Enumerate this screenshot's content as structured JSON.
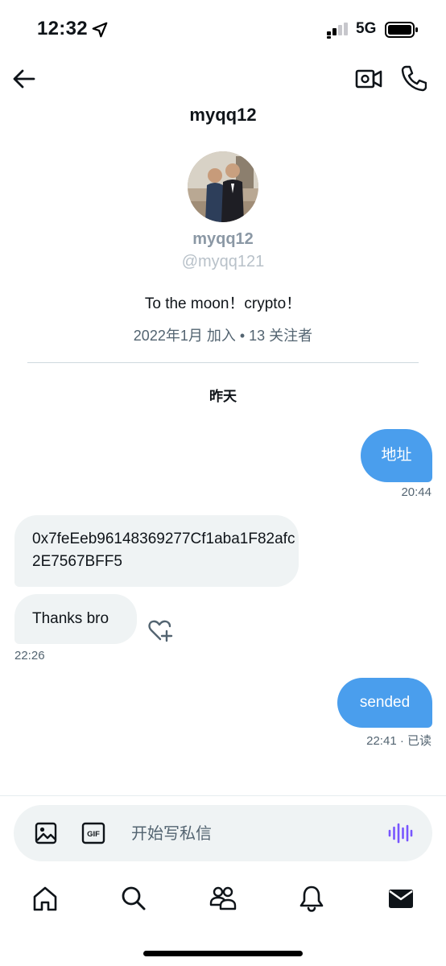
{
  "status_bar": {
    "time": "12:32",
    "network": "5G",
    "icons": [
      "location-arrow-icon",
      "signal-icon",
      "battery-icon"
    ]
  },
  "header": {
    "title": "myqq12",
    "icons": [
      "back-arrow-icon",
      "video-call-icon",
      "phone-call-icon"
    ]
  },
  "profile": {
    "name": "myqq12",
    "handle": "@myqq121",
    "bio": "To the moon！crypto！",
    "meta": "2022年1月 加入 • 13 关注者"
  },
  "conversation": {
    "day_label": "昨天",
    "messages": [
      {
        "direction": "outgoing",
        "text": "地址",
        "time": "20:44"
      },
      {
        "direction": "incoming",
        "text": "0x7feEeb96148369277Cf1aba1F82afc2E7567BFF5"
      },
      {
        "direction": "incoming",
        "text": "Thanks bro",
        "time": "22:26"
      },
      {
        "direction": "outgoing",
        "text": "sended",
        "time": "22:41 · 已读"
      }
    ]
  },
  "composer": {
    "placeholder": "开始写私信",
    "icons": [
      "image-icon",
      "gif-icon",
      "voice-message-icon"
    ]
  },
  "tab_bar": {
    "tabs": [
      "home-icon",
      "search-icon",
      "communities-icon",
      "notifications-icon",
      "messages-icon"
    ]
  },
  "colors": {
    "accent": "#4a9eed",
    "incoming_bubble": "#eff3f4",
    "secondary_text": "#536471",
    "voice_accent": "#7856ff"
  }
}
